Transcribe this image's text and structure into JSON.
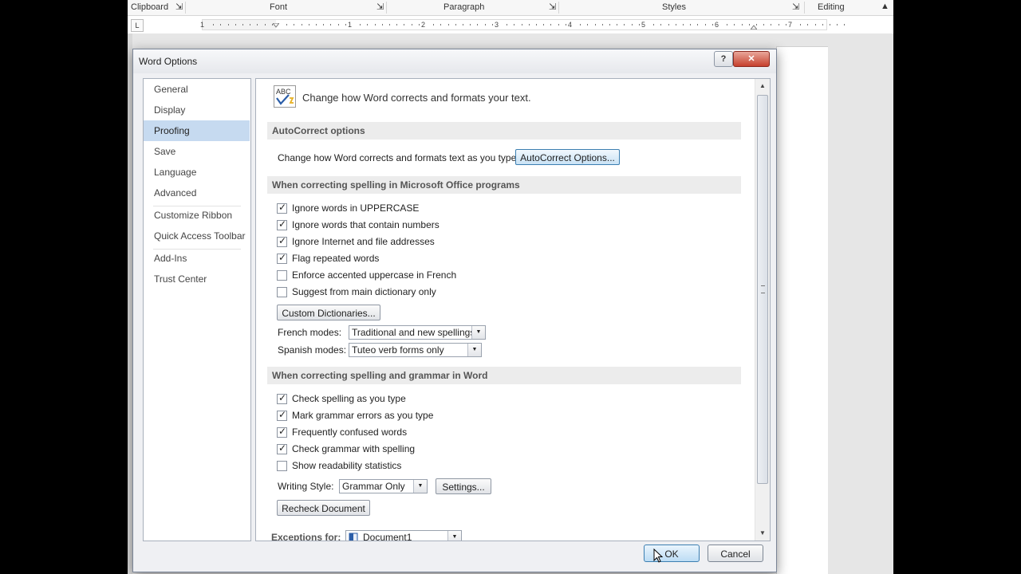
{
  "ribbon": {
    "groups": [
      "Clipboard",
      "Font",
      "Paragraph",
      "Styles",
      "Editing"
    ]
  },
  "ruler": {
    "tab_selector": "L",
    "numbers": [
      "1",
      "1",
      "2",
      "3",
      "4",
      "5",
      "6",
      "7"
    ]
  },
  "dialog": {
    "title": "Word Options",
    "help_label": "?",
    "close_label": "✕",
    "nav": [
      "General",
      "Display",
      "Proofing",
      "Save",
      "Language",
      "Advanced",
      "Customize Ribbon",
      "Quick Access Toolbar",
      "Add-Ins",
      "Trust Center"
    ],
    "selected_nav": "Proofing",
    "header_icon_text": "ABC",
    "header": "Change how Word corrects and formats your text.",
    "autocorrect": {
      "title": "AutoCorrect options",
      "description": "Change how Word corrects and formats text as you type:",
      "button": "AutoCorrect Options..."
    },
    "office": {
      "title": "When correcting spelling in Microsoft Office programs",
      "options": [
        {
          "label": "Ignore words in UPPERCASE",
          "checked": true
        },
        {
          "label": "Ignore words that contain numbers",
          "checked": true
        },
        {
          "label": "Ignore Internet and file addresses",
          "checked": true
        },
        {
          "label": "Flag repeated words",
          "checked": true
        },
        {
          "label": "Enforce accented uppercase in French",
          "checked": false
        },
        {
          "label": "Suggest from main dictionary only",
          "checked": false
        }
      ],
      "custom_dict_button": "Custom Dictionaries...",
      "french_label": "French modes:",
      "french_value": "Traditional and new spellings",
      "spanish_label": "Spanish modes:",
      "spanish_value": "Tuteo verb forms only"
    },
    "word": {
      "title": "When correcting spelling and grammar in Word",
      "options": [
        {
          "label": "Check spelling as you type",
          "checked": true
        },
        {
          "label": "Mark grammar errors as you type",
          "checked": true
        },
        {
          "label": "Frequently confused words",
          "checked": true
        },
        {
          "label": "Check grammar with spelling",
          "checked": true
        },
        {
          "label": "Show readability statistics",
          "checked": false
        }
      ],
      "writing_style_label": "Writing Style:",
      "writing_style_value": "Grammar Only",
      "settings_button": "Settings...",
      "recheck_button": "Recheck Document"
    },
    "exceptions_label": "Exceptions for:",
    "exceptions_value": "Document1",
    "ok_button": "OK",
    "cancel_button": "Cancel",
    "check_mark": "✓"
  },
  "colors": {
    "selected_nav": "#c6daf0",
    "section_bg": "#ececec",
    "focus_border": "#3c7fb1"
  }
}
